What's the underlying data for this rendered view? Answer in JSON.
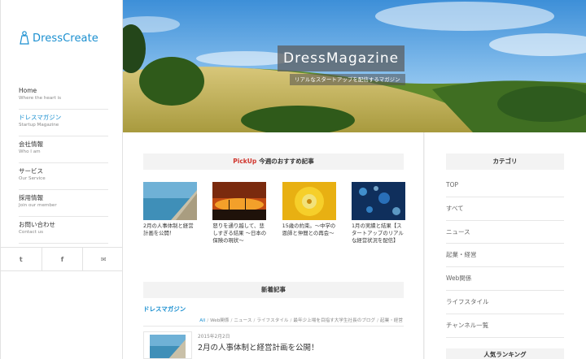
{
  "sidebar": {
    "logo_text": "DressCreate",
    "nav": [
      {
        "label": "Home",
        "sub": "Where the heart is"
      },
      {
        "label": "ドレスマガジン",
        "sub": "Startup Magazine"
      },
      {
        "label": "会社情報",
        "sub": "Who I am"
      },
      {
        "label": "サービス",
        "sub": "Our Service"
      },
      {
        "label": "採用情報",
        "sub": "Join our member"
      },
      {
        "label": "お問い合わせ",
        "sub": "Contact us"
      }
    ],
    "social": [
      "t",
      "f",
      "✉"
    ]
  },
  "hero": {
    "title": "DressMagazine",
    "subtitle": "リアルなスタートアップを配信するマガジン"
  },
  "pickup": {
    "prefix": "PickUp",
    "title": "今週のおすすめ記事",
    "cards": [
      "2月の人事体制と経営計画を公開！",
      "怒りを通り越して、悲しすぎる結果 〜日本の保険の現状〜",
      "15歳の約束。〜中学の恩師と仲間との再会〜",
      "1月の実績と結果【スタートアップのリアルな経営状況を配信】"
    ]
  },
  "latest": {
    "title": "新着記事",
    "category": "ドレスマガジン",
    "filters": [
      "All",
      "Web関係",
      "ニュース",
      "ライフスタイル",
      "最年少上場を目指す大学生社長のブログ",
      "起業・経営"
    ],
    "item": {
      "date": "2015年2月2日",
      "title": "2月の人事体制と経営計画を公開！"
    }
  },
  "categories": {
    "title": "カテゴリ",
    "items": [
      "TOP",
      "すべて",
      "ニュース",
      "起業・経営",
      "Web関係",
      "ライフスタイル",
      "チャンネル一覧"
    ]
  },
  "ranking": {
    "title": "人気ランキング"
  },
  "colors": {
    "accent": "#1a8fd0",
    "pickup": "#d0342c"
  }
}
